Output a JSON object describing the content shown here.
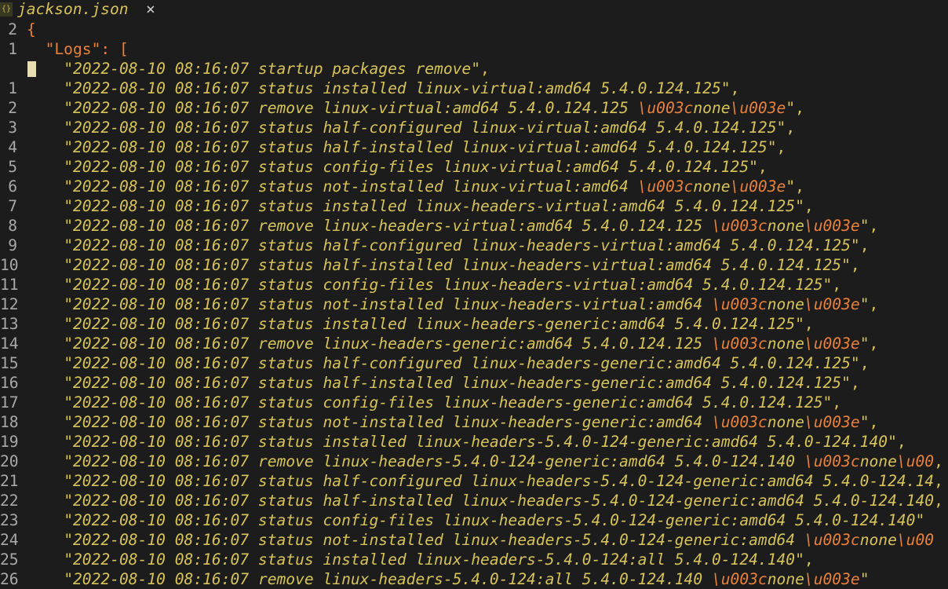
{
  "tab": {
    "icon": "json-file-icon",
    "title": "jackson.json",
    "close": "×"
  },
  "editor": {
    "line_numbers": [
      "2",
      "1",
      "",
      "1",
      "2",
      "3",
      "4",
      "5",
      "6",
      "7",
      "8",
      "9",
      "10",
      "11",
      "12",
      "13",
      "14",
      "15",
      "16",
      "17",
      "18",
      "19",
      "20",
      "21",
      "22",
      "23",
      "24",
      "25",
      "26"
    ],
    "open_brace": "{",
    "logs_key": "\"Logs\"",
    "logs_sep": ": [",
    "entries": [
      "\"2022-08-10 08:16:07 startup packages remove\"",
      "\"2022-08-10 08:16:07 status installed linux-virtual:amd64 5.4.0.124.125\"",
      "\"2022-08-10 08:16:07 remove linux-virtual:amd64 5.4.0.124.125 \\u003cnone\\u003e\"",
      "\"2022-08-10 08:16:07 status half-configured linux-virtual:amd64 5.4.0.124.125\"",
      "\"2022-08-10 08:16:07 status half-installed linux-virtual:amd64 5.4.0.124.125\"",
      "\"2022-08-10 08:16:07 status config-files linux-virtual:amd64 5.4.0.124.125\"",
      "\"2022-08-10 08:16:07 status not-installed linux-virtual:amd64 \\u003cnone\\u003e\"",
      "\"2022-08-10 08:16:07 status installed linux-headers-virtual:amd64 5.4.0.124.125\"",
      "\"2022-08-10 08:16:07 remove linux-headers-virtual:amd64 5.4.0.124.125 \\u003cnone\\u003e\"",
      "\"2022-08-10 08:16:07 status half-configured linux-headers-virtual:amd64 5.4.0.124.125\"",
      "\"2022-08-10 08:16:07 status half-installed linux-headers-virtual:amd64 5.4.0.124.125\"",
      "\"2022-08-10 08:16:07 status config-files linux-headers-virtual:amd64 5.4.0.124.125\"",
      "\"2022-08-10 08:16:07 status not-installed linux-headers-virtual:amd64 \\u003cnone\\u003e\"",
      "\"2022-08-10 08:16:07 status installed linux-headers-generic:amd64 5.4.0.124.125\"",
      "\"2022-08-10 08:16:07 remove linux-headers-generic:amd64 5.4.0.124.125 \\u003cnone\\u003e\"",
      "\"2022-08-10 08:16:07 status half-configured linux-headers-generic:amd64 5.4.0.124.125\"",
      "\"2022-08-10 08:16:07 status half-installed linux-headers-generic:amd64 5.4.0.124.125\"",
      "\"2022-08-10 08:16:07 status config-files linux-headers-generic:amd64 5.4.0.124.125\"",
      "\"2022-08-10 08:16:07 status not-installed linux-headers-generic:amd64 \\u003cnone\\u003e\"",
      "\"2022-08-10 08:16:07 status installed linux-headers-5.4.0-124-generic:amd64 5.4.0-124.140\"",
      "\"2022-08-10 08:16:07 remove linux-headers-5.4.0-124-generic:amd64 5.4.0-124.140 \\u003cnone\\u00",
      "\"2022-08-10 08:16:07 status half-configured linux-headers-5.4.0-124-generic:amd64 5.4.0-124.14",
      "\"2022-08-10 08:16:07 status half-installed linux-headers-5.4.0-124-generic:amd64 5.4.0-124.140",
      "\"2022-08-10 08:16:07 status config-files linux-headers-5.4.0-124-generic:amd64 5.4.0-124.140\"",
      "\"2022-08-10 08:16:07 status not-installed linux-headers-5.4.0-124-generic:amd64 \\u003cnone\\u00",
      "\"2022-08-10 08:16:07 status installed linux-headers-5.4.0-124:all 5.4.0-124.140\"",
      "\"2022-08-10 08:16:07 remove linux-headers-5.4.0-124:all 5.4.0-124.140 \\u003cnone\\u003e\""
    ],
    "trailing": [
      ",",
      ",",
      ",",
      ",",
      ",",
      ",",
      ",",
      ",",
      ",",
      ",",
      ",",
      ",",
      ",",
      ",",
      ",",
      ",",
      ",",
      ",",
      ",",
      ",",
      ",",
      ",",
      ",",
      "",
      "",
      ",",
      "",
      ",",
      ","
    ],
    "colors": {
      "background": "#1c1c1c",
      "string": "#d6c35a",
      "key": "#e8813c",
      "gutter": "#a9a9a9"
    }
  }
}
